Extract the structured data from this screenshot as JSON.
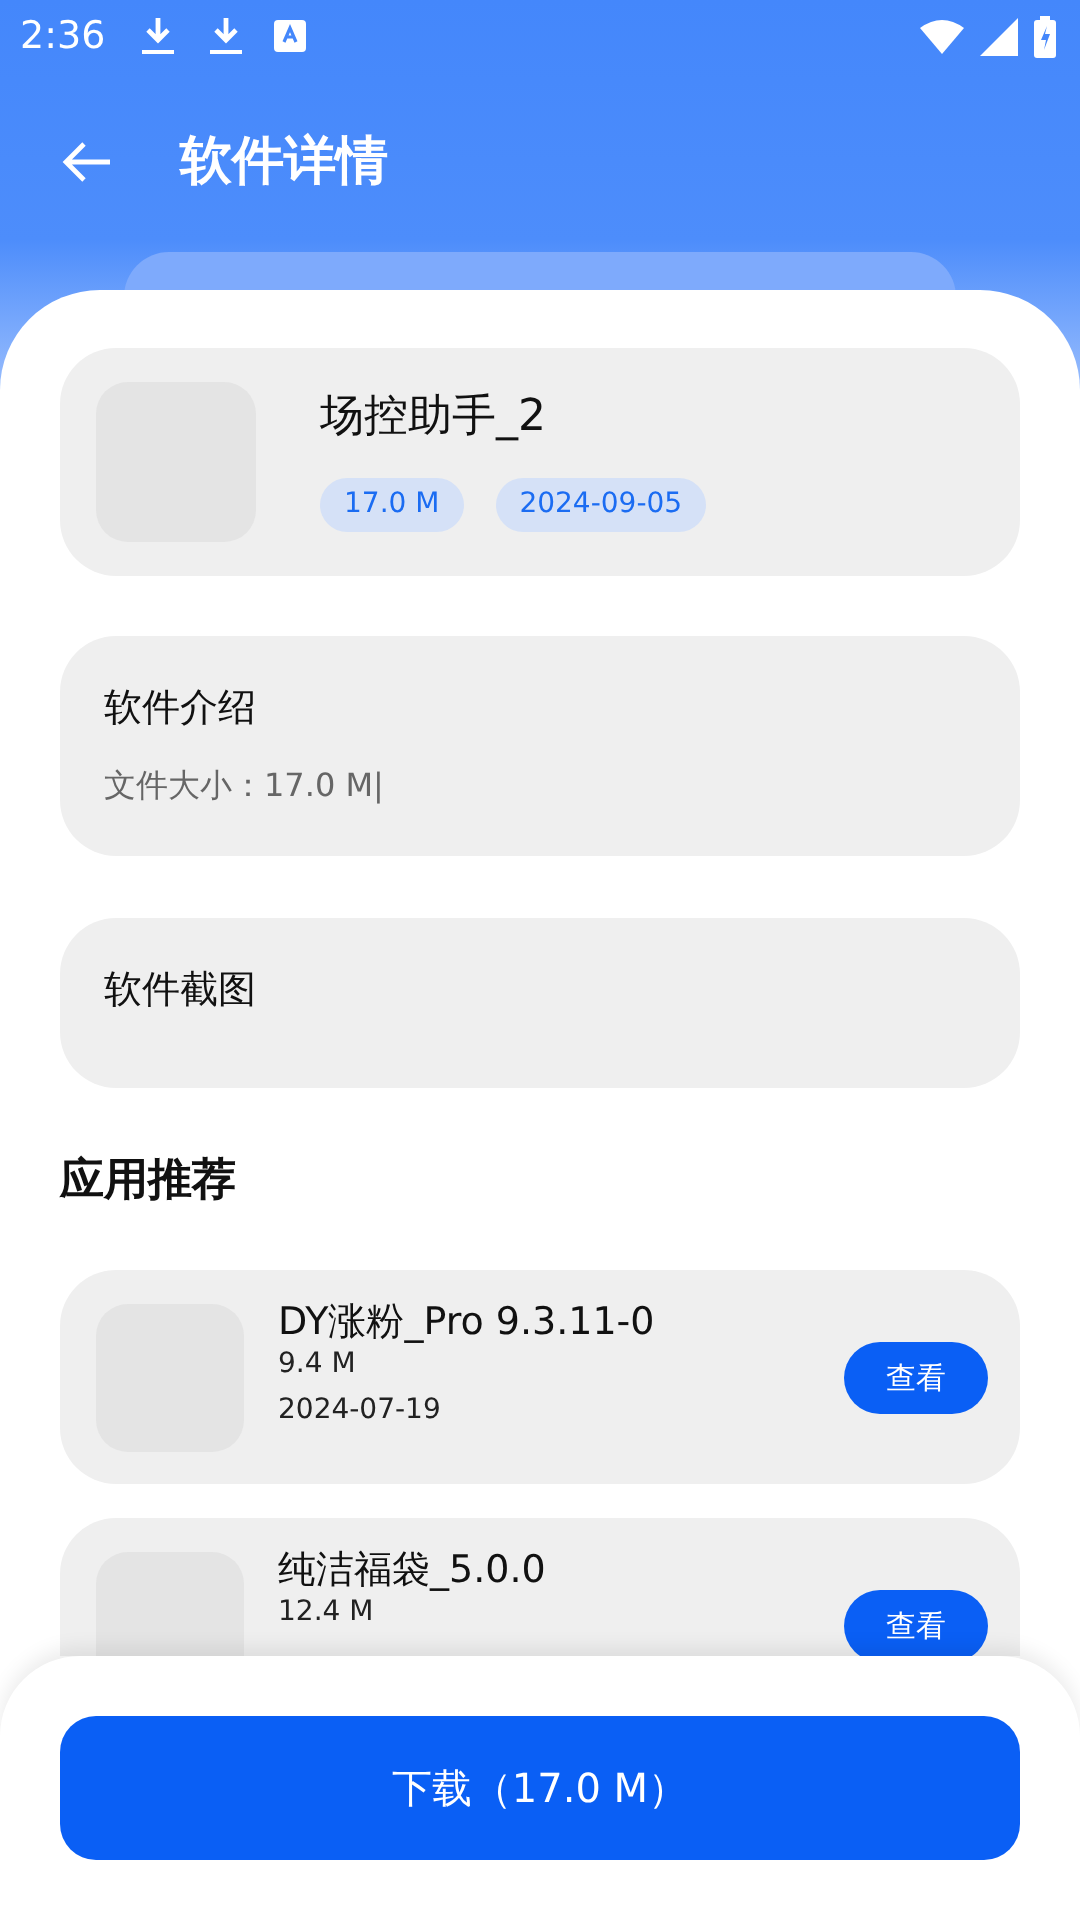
{
  "status_bar": {
    "time": "2:36"
  },
  "header": {
    "title": "软件详情"
  },
  "app": {
    "name": "场控助手_2",
    "tags": [
      "17.0 M",
      "2024-09-05"
    ]
  },
  "intro": {
    "title": "软件介绍",
    "text": "文件大小：17.0 M|"
  },
  "screenshots": {
    "title": "软件截图"
  },
  "recommend": {
    "title": "应用推荐",
    "items": [
      {
        "name": "DY涨粉_Pro 9.3.11-0",
        "size": "9.4 M",
        "date": "2024-07-19",
        "button": "查看"
      },
      {
        "name": "纯洁福袋_5.0.0",
        "size": "12.4 M",
        "button": "查看"
      }
    ]
  },
  "download_button": "下载（17.0 M）"
}
